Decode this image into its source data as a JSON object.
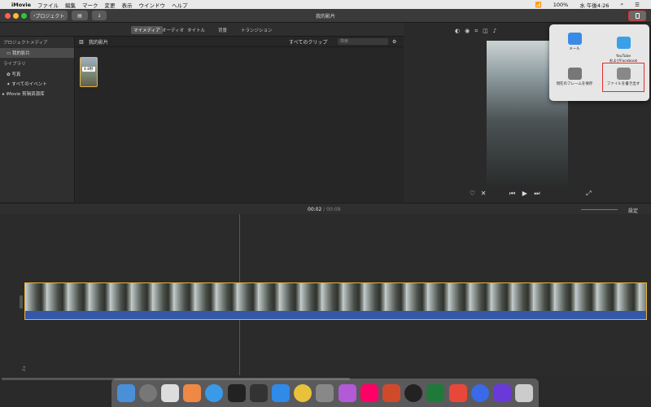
{
  "menubar": {
    "app_name": "iMovie",
    "items": [
      "ファイル",
      "編集",
      "マーク",
      "変更",
      "表示",
      "ウインドウ",
      "ヘルプ"
    ],
    "battery": "100%",
    "clock": "水 午後4:26"
  },
  "toolbar": {
    "back_label": "プロジェクト",
    "window_title": "我的影片"
  },
  "tabs": [
    "マイメディア",
    "オーディオ",
    "タイトル",
    "背景",
    "トランジション"
  ],
  "sidebar": {
    "section_project": "プロジェクトメディア",
    "project_item": "我的影片",
    "section_library": "ライブラリ",
    "library_items": [
      "写真",
      "すべてのイベント",
      "iMovie 剪辑资源库"
    ]
  },
  "browser": {
    "title": "我的影片",
    "filter": "すべてのクリップ",
    "search_placeholder": "検索",
    "clip_duration": "4.8秒"
  },
  "share_menu": {
    "items": [
      "メール",
      "YouTube\nおよびFacebook",
      "現在のフレームを保存",
      "ファイルを書き出す"
    ]
  },
  "timeline": {
    "current_time": "00:02",
    "total_time": "00:09",
    "settings_label": "設定"
  },
  "colors": {
    "highlight": "#e03030",
    "clip_border": "#e8b33a",
    "audio_wave": "#3458a8"
  }
}
